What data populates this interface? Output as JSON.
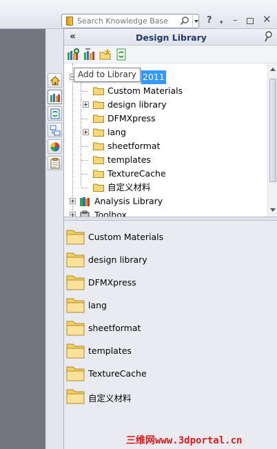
{
  "topbar": {
    "search_placeholder": "Search Knowledge Base",
    "help_label": "?",
    "help_dropdown_label": "▾",
    "minimize_label": "–",
    "close_label": "✕"
  },
  "panel": {
    "title": "Design Library",
    "collapse_label": "«"
  },
  "tooltip": "Add to Library",
  "tree": {
    "root_label": "2011",
    "items": [
      {
        "label": "Custom Materials"
      },
      {
        "label": "design library"
      },
      {
        "label": "DFMXpress"
      },
      {
        "label": "lang"
      },
      {
        "label": "sheetformat"
      },
      {
        "label": "templates"
      },
      {
        "label": "TextureCache"
      },
      {
        "label": "自定义材料"
      }
    ],
    "analysis_library": "Analysis Library",
    "toolbox": "Toolbox"
  },
  "folder_list": [
    "Custom Materials",
    "design library",
    "DFMXpress",
    "lang",
    "sheetformat",
    "templates",
    "TextureCache",
    "自定义材料"
  ],
  "watermark": "三维网www.3dportal.cn",
  "colors": {
    "selection": "#3399ff",
    "folder": "#f7d878",
    "watermark": "#e0191a"
  }
}
